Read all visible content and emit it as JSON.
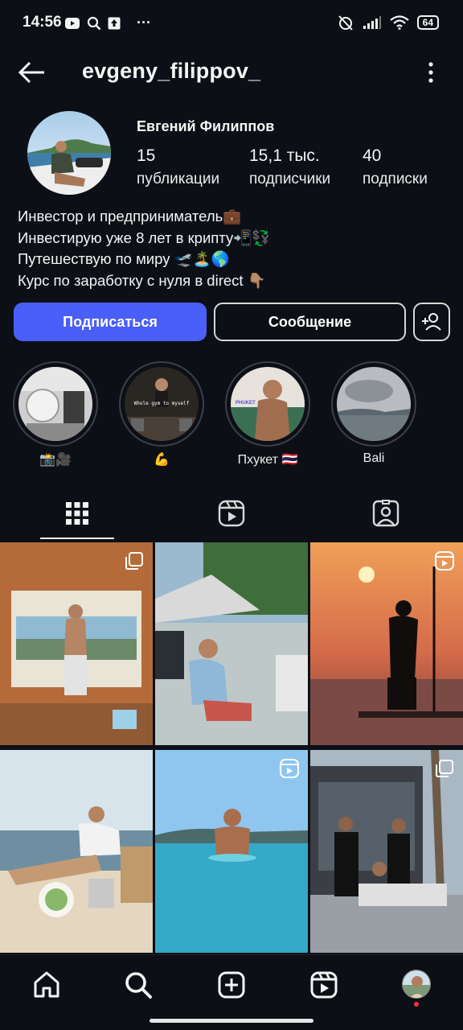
{
  "status_bar": {
    "time": "14:56",
    "more_indicator": "···",
    "battery": "64"
  },
  "header": {
    "username": "evgeny_filippov_",
    "back_icon": "arrow-left-icon",
    "more_icon": "vertical-dots-icon"
  },
  "profile": {
    "full_name": "Евгений Филиппов",
    "stats": [
      {
        "value": "15",
        "label": "публикации"
      },
      {
        "value": "15,1 тыс.",
        "label": "подписчики"
      },
      {
        "value": "40",
        "label": "подписки"
      }
    ],
    "bio": [
      "Инвестор и предприниматель💼",
      "Инвестирую уже 8 лет в крипту📲💱",
      "Путешествую по миру 🛫🏝️🌎",
      "Курс по заработку с нуля в direct 👇🏽"
    ]
  },
  "actions": {
    "follow_label": "Подписаться",
    "message_label": "Сообщение",
    "add_friend_icon": "person-plus-icon"
  },
  "highlights": [
    {
      "label": "📸🎥"
    },
    {
      "label": "💪",
      "image_text": "Whole gym to myself"
    },
    {
      "label": "Пхукет 🇹🇭",
      "image_text": "PHUKET"
    },
    {
      "label": "Bali"
    }
  ],
  "tabs": [
    {
      "icon": "grid-icon",
      "active": true
    },
    {
      "icon": "reels-icon",
      "active": false
    },
    {
      "icon": "tagged-icon",
      "active": false
    }
  ],
  "grid_posts": [
    {
      "type": "carousel"
    },
    {
      "type": "photo"
    },
    {
      "type": "reel"
    },
    {
      "type": "photo"
    },
    {
      "type": "reel"
    },
    {
      "type": "carousel"
    }
  ],
  "bottom_nav": [
    {
      "icon": "home-icon"
    },
    {
      "icon": "search-icon"
    },
    {
      "icon": "create-icon"
    },
    {
      "icon": "reels-icon"
    },
    {
      "icon": "profile-avatar"
    }
  ],
  "colors": {
    "background": "#0c1016",
    "accent": "#4a5ef8",
    "notification_dot": "#ff3040"
  }
}
